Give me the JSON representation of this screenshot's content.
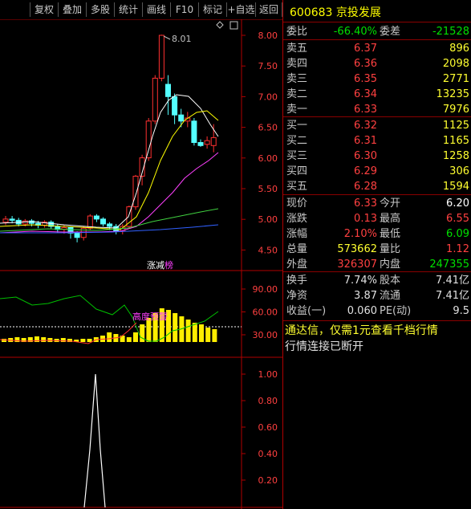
{
  "toolbar": {
    "buttons": [
      "复权",
      "叠加",
      "多股",
      "统计",
      "画线",
      "F10",
      "标记",
      "+自选",
      "返回"
    ]
  },
  "stock": {
    "code": "600683",
    "name": "京投发展"
  },
  "main_axis": {
    "ticks": [
      "8.00",
      "7.50",
      "7.00",
      "6.50",
      "6.00",
      "5.50",
      "5.00",
      "4.50"
    ]
  },
  "high_marker": "8.01",
  "badge": {
    "text1": "涨减",
    "text2": "榜"
  },
  "indicator_axis": {
    "ticks": [
      "90.00",
      "60.00",
      "30.00"
    ]
  },
  "indicator_overlay": "高度预警",
  "volume_axis": {
    "ticks": [
      "1.00",
      "0.80",
      "0.60",
      "0.40",
      "0.20"
    ]
  },
  "quote": {
    "weibi_label": "委比",
    "weibi_value": "-66.40%",
    "weicha_label": "委差",
    "weicha_value": "-21528",
    "asks": [
      {
        "label": "卖五",
        "price": "6.37",
        "vol": "896"
      },
      {
        "label": "卖四",
        "price": "6.36",
        "vol": "2098"
      },
      {
        "label": "卖三",
        "price": "6.35",
        "vol": "2771"
      },
      {
        "label": "卖二",
        "price": "6.34",
        "vol": "13235"
      },
      {
        "label": "卖一",
        "price": "6.33",
        "vol": "7976"
      }
    ],
    "bids": [
      {
        "label": "买一",
        "price": "6.32",
        "vol": "1125"
      },
      {
        "label": "买二",
        "price": "6.31",
        "vol": "1165"
      },
      {
        "label": "买三",
        "price": "6.30",
        "vol": "1258"
      },
      {
        "label": "买四",
        "price": "6.29",
        "vol": "306"
      },
      {
        "label": "买五",
        "price": "6.28",
        "vol": "1594"
      }
    ],
    "stats": [
      {
        "l1": "现价",
        "v1": "6.33",
        "l2": "今开",
        "v2": "6.20"
      },
      {
        "l1": "涨跌",
        "v1": "0.13",
        "l2": "最高",
        "v2": "6.55"
      },
      {
        "l1": "涨幅",
        "v1": "2.10%",
        "l2": "最低",
        "v2": "6.09"
      },
      {
        "l1": "总量",
        "v1": "573662",
        "l2": "量比",
        "v2": "1.12"
      },
      {
        "l1": "外盘",
        "v1": "326307",
        "l2": "内盘",
        "v2": "247355"
      }
    ],
    "extra": [
      {
        "l1": "换手",
        "v1": "7.74%",
        "l2": "股本",
        "v2": "7.41亿"
      },
      {
        "l1": "净资",
        "v1": "3.87",
        "l2": "流通",
        "v2": "7.41亿"
      },
      {
        "l1": "收益(一)",
        "v1": "0.060",
        "l2": "PE(动)",
        "v2": "9.5"
      }
    ],
    "notice": "通达信，仅需1元查看千档行情",
    "disconnected": "行情连接已断开"
  },
  "chart_data": {
    "type": "candlestick",
    "candles": [
      {
        "o": 4.95,
        "c": 5.0,
        "h": 5.05,
        "l": 4.9
      },
      {
        "o": 5.0,
        "c": 4.98,
        "h": 5.05,
        "l": 4.93
      },
      {
        "o": 4.98,
        "c": 4.92,
        "h": 5.02,
        "l": 4.88
      },
      {
        "o": 4.92,
        "c": 4.97,
        "h": 5.0,
        "l": 4.88
      },
      {
        "o": 4.97,
        "c": 4.93,
        "h": 5.0,
        "l": 4.88
      },
      {
        "o": 4.93,
        "c": 4.9,
        "h": 4.97,
        "l": 4.85
      },
      {
        "o": 4.9,
        "c": 4.95,
        "h": 4.98,
        "l": 4.86
      },
      {
        "o": 4.95,
        "c": 4.88,
        "h": 4.98,
        "l": 4.84
      },
      {
        "o": 4.88,
        "c": 4.83,
        "h": 4.92,
        "l": 4.78
      },
      {
        "o": 4.83,
        "c": 4.86,
        "h": 4.9,
        "l": 4.76
      },
      {
        "o": 4.86,
        "c": 4.77,
        "h": 4.88,
        "l": 4.68
      },
      {
        "o": 4.77,
        "c": 4.7,
        "h": 4.8,
        "l": 4.62
      },
      {
        "o": 4.7,
        "c": 4.85,
        "h": 4.88,
        "l": 4.65
      },
      {
        "o": 4.85,
        "c": 5.05,
        "h": 5.08,
        "l": 4.82
      },
      {
        "o": 5.05,
        "c": 5.0,
        "h": 5.08,
        "l": 4.95
      },
      {
        "o": 5.0,
        "c": 4.92,
        "h": 5.03,
        "l": 4.88
      },
      {
        "o": 4.92,
        "c": 4.88,
        "h": 4.95,
        "l": 4.82
      },
      {
        "o": 4.88,
        "c": 4.8,
        "h": 4.92,
        "l": 4.75
      },
      {
        "o": 4.8,
        "c": 4.88,
        "h": 4.92,
        "l": 4.75
      },
      {
        "o": 4.88,
        "c": 5.2,
        "h": 5.22,
        "l": 4.85
      },
      {
        "o": 5.2,
        "c": 5.7,
        "h": 5.72,
        "l": 5.15
      },
      {
        "o": 5.7,
        "c": 6.0,
        "h": 6.05,
        "l": 5.55
      },
      {
        "o": 6.0,
        "c": 6.6,
        "h": 6.65,
        "l": 5.95
      },
      {
        "o": 6.6,
        "c": 7.3,
        "h": 7.35,
        "l": 6.55
      },
      {
        "o": 7.3,
        "c": 8.0,
        "h": 8.01,
        "l": 7.25
      },
      {
        "o": 7.2,
        "c": 7.0,
        "h": 7.35,
        "l": 6.7
      },
      {
        "o": 7.0,
        "c": 6.7,
        "h": 7.05,
        "l": 6.55
      },
      {
        "o": 6.7,
        "c": 6.6,
        "h": 6.8,
        "l": 6.5
      },
      {
        "o": 6.6,
        "c": 6.65,
        "h": 6.75,
        "l": 6.5
      },
      {
        "o": 6.6,
        "c": 6.25,
        "h": 6.65,
        "l": 6.2
      },
      {
        "o": 6.25,
        "c": 6.2,
        "h": 6.3,
        "l": 6.18
      },
      {
        "o": 6.22,
        "c": 6.28,
        "h": 6.35,
        "l": 6.15
      },
      {
        "o": 6.2,
        "c": 6.33,
        "h": 6.55,
        "l": 6.09
      }
    ]
  }
}
